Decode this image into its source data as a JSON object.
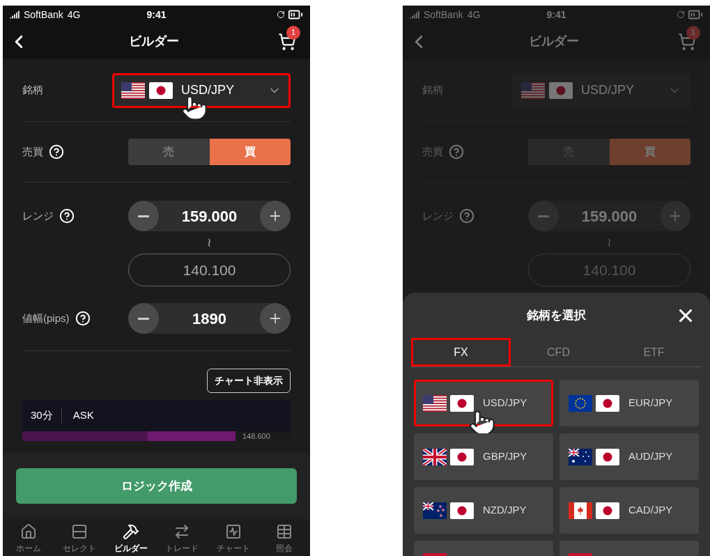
{
  "screens": [
    {
      "dimmed": false,
      "status_bar": {
        "carrier": "SoftBank",
        "network": "4G",
        "time": "9:41"
      },
      "header": {
        "title": "ビルダー",
        "cart_badge": "1"
      },
      "symbol_row": {
        "label": "銘柄",
        "value": "USD/JPY",
        "flags": [
          {
            "kind": "us"
          },
          {
            "kind": "jp"
          }
        ],
        "highlighted": true,
        "tapped": true
      },
      "side_row": {
        "label": "売買",
        "options": [
          {
            "label": "売",
            "selected": false
          },
          {
            "label": "買",
            "selected": true
          }
        ]
      },
      "range_row": {
        "label": "レンジ",
        "upper": "159.000",
        "separator": "≀",
        "lower": "140.100"
      },
      "pips_row": {
        "label": "値幅(pips)",
        "value": "1890"
      },
      "chart_toggle": "チャート非表示",
      "chart": {
        "interval": "30分",
        "price_type": "ASK",
        "price_label": "148.600"
      },
      "primary_button": "ロジック作成",
      "tab_bar": [
        {
          "label": "ホーム",
          "selected": false
        },
        {
          "label": "セレクト",
          "selected": false
        },
        {
          "label": "ビルダー",
          "selected": true
        },
        {
          "label": "トレード",
          "selected": false
        },
        {
          "label": "チャート",
          "selected": false
        },
        {
          "label": "照会",
          "selected": false
        }
      ]
    },
    {
      "dimmed": true,
      "status_bar": {
        "carrier": "SoftBank",
        "network": "4G",
        "time": "9:41"
      },
      "header": {
        "title": "ビルダー",
        "cart_badge": "1"
      },
      "symbol_row": {
        "label": "銘柄",
        "value": "USD/JPY",
        "flags": [
          {
            "kind": "us"
          },
          {
            "kind": "jp"
          }
        ],
        "highlighted": false,
        "tapped": false
      },
      "side_row": {
        "label": "売買",
        "options": [
          {
            "label": "売",
            "selected": false
          },
          {
            "label": "買",
            "selected": true
          }
        ]
      },
      "range_row": {
        "label": "レンジ",
        "upper": "159.000",
        "separator": "≀",
        "lower": "140.100"
      },
      "sheet": {
        "title": "銘柄を選択",
        "tabs": [
          {
            "label": "FX",
            "selected": true,
            "highlighted": true
          },
          {
            "label": "CFD",
            "selected": false,
            "highlighted": false
          },
          {
            "label": "ETF",
            "selected": false,
            "highlighted": false
          }
        ],
        "pairs": [
          {
            "kind": "pair",
            "label": "USD/JPY",
            "flags": [
              {
                "kind": "us"
              },
              {
                "kind": "jp"
              }
            ],
            "highlighted": true,
            "tapped": true
          },
          {
            "kind": "pair",
            "label": "EUR/JPY",
            "flags": [
              {
                "kind": "eu"
              },
              {
                "kind": "jp"
              }
            ],
            "highlighted": false,
            "tapped": false
          },
          {
            "kind": "pair",
            "label": "GBP/JPY",
            "flags": [
              {
                "kind": "gb"
              },
              {
                "kind": "jp"
              }
            ],
            "highlighted": false,
            "tapped": false
          },
          {
            "kind": "pair",
            "label": "AUD/JPY",
            "flags": [
              {
                "kind": "au"
              },
              {
                "kind": "jp"
              }
            ],
            "highlighted": false,
            "tapped": false
          },
          {
            "kind": "pair",
            "label": "NZD/JPY",
            "flags": [
              {
                "kind": "nz"
              },
              {
                "kind": "jp"
              }
            ],
            "highlighted": false,
            "tapped": false
          },
          {
            "kind": "pair",
            "label": "CAD/JPY",
            "flags": [
              {
                "kind": "ca"
              },
              {
                "kind": "jp"
              }
            ],
            "highlighted": false,
            "tapped": false
          },
          {
            "kind": "partial"
          },
          {
            "kind": "partial"
          }
        ]
      }
    }
  ]
}
